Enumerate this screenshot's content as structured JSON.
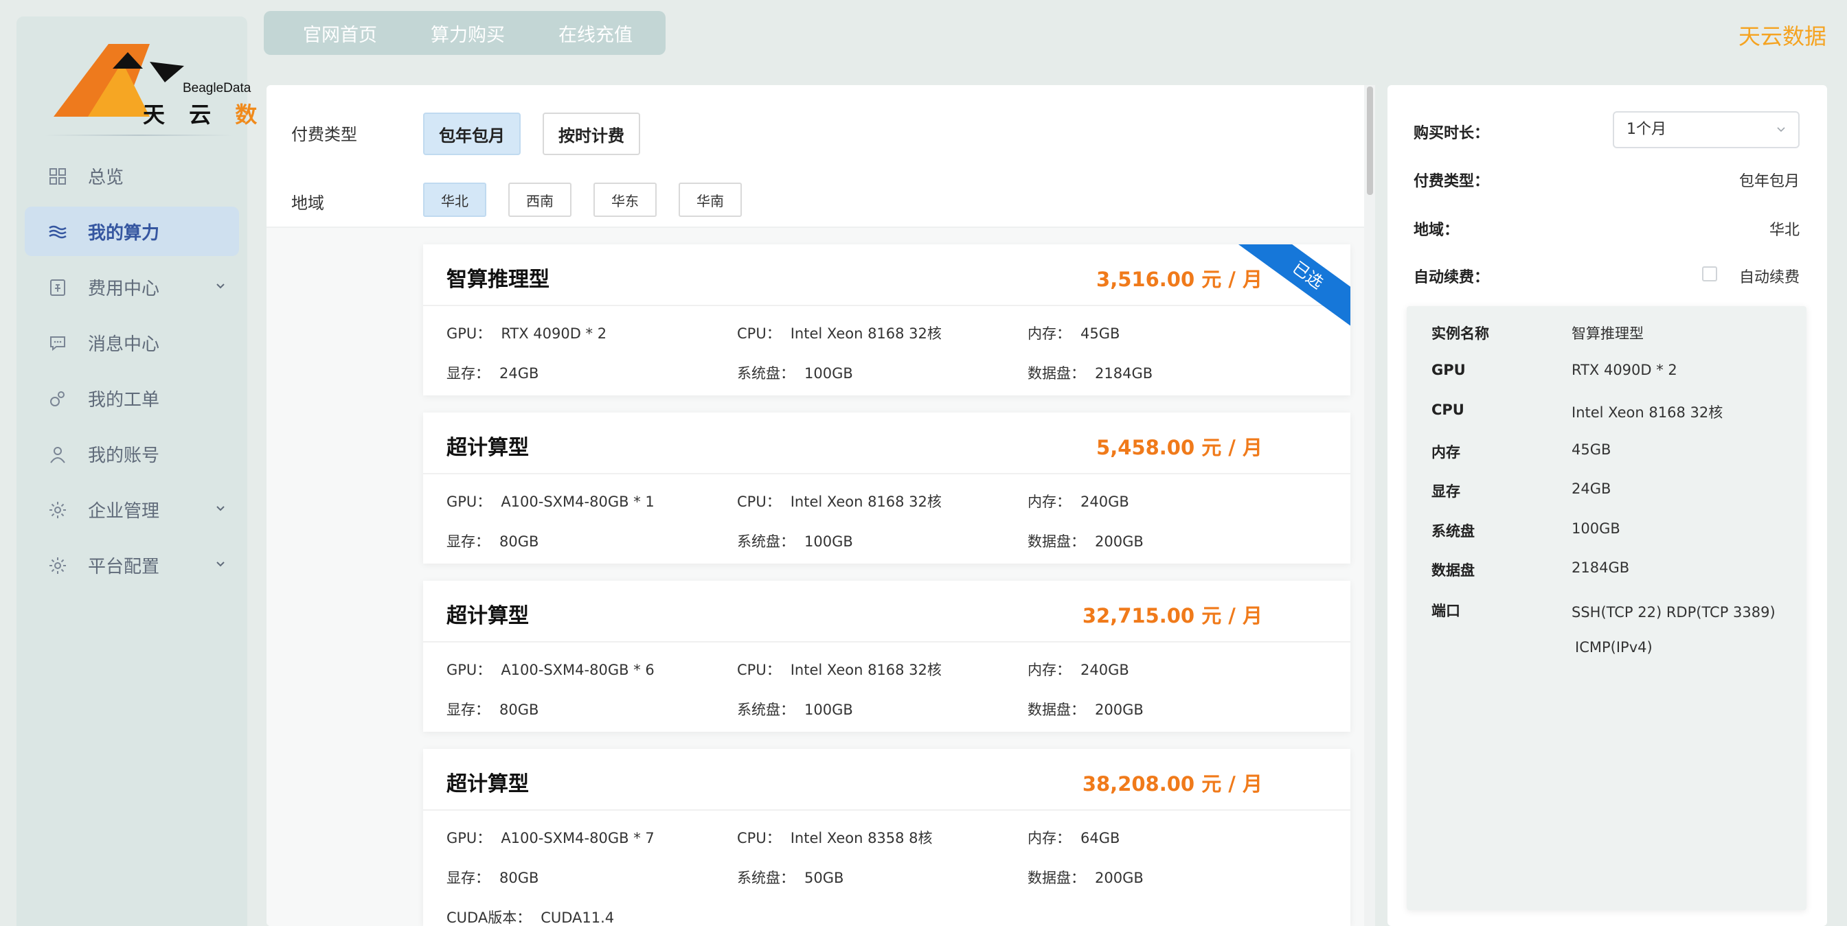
{
  "logo": {
    "en": "BeagleData",
    "cn_part1": "天 云 ",
    "cn_part2": "数 据"
  },
  "sidebar": {
    "items": [
      {
        "label": "总览",
        "icon": "grid-icon"
      },
      {
        "label": "我的算力",
        "icon": "compute-icon",
        "active": true
      },
      {
        "label": "费用中心",
        "icon": "billing-icon",
        "expandable": true
      },
      {
        "label": "消息中心",
        "icon": "message-icon"
      },
      {
        "label": "我的工单",
        "icon": "ticket-icon"
      },
      {
        "label": "我的账号",
        "icon": "user-icon"
      },
      {
        "label": "企业管理",
        "icon": "gear-icon",
        "expandable": true
      },
      {
        "label": "平台配置",
        "icon": "gear-icon",
        "expandable": true
      }
    ]
  },
  "topnav": {
    "items": [
      "官网首页",
      "算力购买",
      "在线充值"
    ]
  },
  "brand": "天云数据",
  "filters": {
    "pay_type_label": "付费类型",
    "pay_types": [
      "包年包月",
      "按时计费"
    ],
    "region_label": "地域",
    "regions": [
      "华北",
      "西南",
      "华东",
      "华南"
    ]
  },
  "cards": [
    {
      "title": "智算推理型",
      "price": "3,516.00 元 / 月",
      "selected_badge": "已选",
      "gpu_k": "GPU：",
      "gpu": "RTX 4090D * 2",
      "cpu_k": "CPU：",
      "cpu": "Intel Xeon 8168 32核",
      "mem_k": "内存：",
      "mem": "45GB",
      "vram_k": "显存：",
      "vram": "24GB",
      "sys_k": "系统盘：",
      "sys": "100GB",
      "data_k": "数据盘：",
      "data": "2184GB"
    },
    {
      "title": "超计算型",
      "price": "5,458.00 元 / 月",
      "gpu_k": "GPU：",
      "gpu": "A100-SXM4-80GB * 1",
      "cpu_k": "CPU：",
      "cpu": "Intel Xeon 8168 32核",
      "mem_k": "内存：",
      "mem": "240GB",
      "vram_k": "显存：",
      "vram": "80GB",
      "sys_k": "系统盘：",
      "sys": "100GB",
      "data_k": "数据盘：",
      "data": "200GB"
    },
    {
      "title": "超计算型",
      "price": "32,715.00 元 / 月",
      "gpu_k": "GPU：",
      "gpu": "A100-SXM4-80GB * 6",
      "cpu_k": "CPU：",
      "cpu": "Intel Xeon 8168 32核",
      "mem_k": "内存：",
      "mem": "240GB",
      "vram_k": "显存：",
      "vram": "80GB",
      "sys_k": "系统盘：",
      "sys": "100GB",
      "data_k": "数据盘：",
      "data": "200GB"
    },
    {
      "title": "超计算型",
      "price": "38,208.00 元 / 月",
      "gpu_k": "GPU：",
      "gpu": "A100-SXM4-80GB * 7",
      "cpu_k": "CPU：",
      "cpu": "Intel Xeon 8358 8核",
      "mem_k": "内存：",
      "mem": "64GB",
      "vram_k": "显存：",
      "vram": "80GB",
      "sys_k": "系统盘：",
      "sys": "50GB",
      "data_k": "数据盘：",
      "data": "200GB",
      "cuda_k": "CUDA版本：",
      "cuda": "CUDA11.4"
    }
  ],
  "summary": {
    "duration_label": "购买时长：",
    "duration_value": "1个月",
    "pay_type_label": "付费类型：",
    "pay_type_value": "包年包月",
    "region_label": "地域：",
    "region_value": "华北",
    "auto_renew_label": "自动续费：",
    "auto_renew_checkbox_label": "自动续费",
    "details": [
      {
        "k": "实例名称",
        "v": "智算推理型"
      },
      {
        "k": "GPU",
        "v": "RTX 4090D * 2"
      },
      {
        "k": "CPU",
        "v": "Intel Xeon 8168 32核"
      },
      {
        "k": "内存",
        "v": "45GB"
      },
      {
        "k": "显存",
        "v": "24GB"
      },
      {
        "k": "系统盘",
        "v": "100GB"
      },
      {
        "k": "数据盘",
        "v": "2184GB"
      },
      {
        "k": "端口",
        "v": "SSH(TCP 22)  RDP(TCP 3389)",
        "v2": "ICMP(IPv4)"
      }
    ]
  },
  "colors": {
    "accent_orange": "#f07a1a",
    "brand_orange": "#f5a321",
    "active_blue": "#3556a0",
    "ribbon_blue": "#1677d9"
  }
}
